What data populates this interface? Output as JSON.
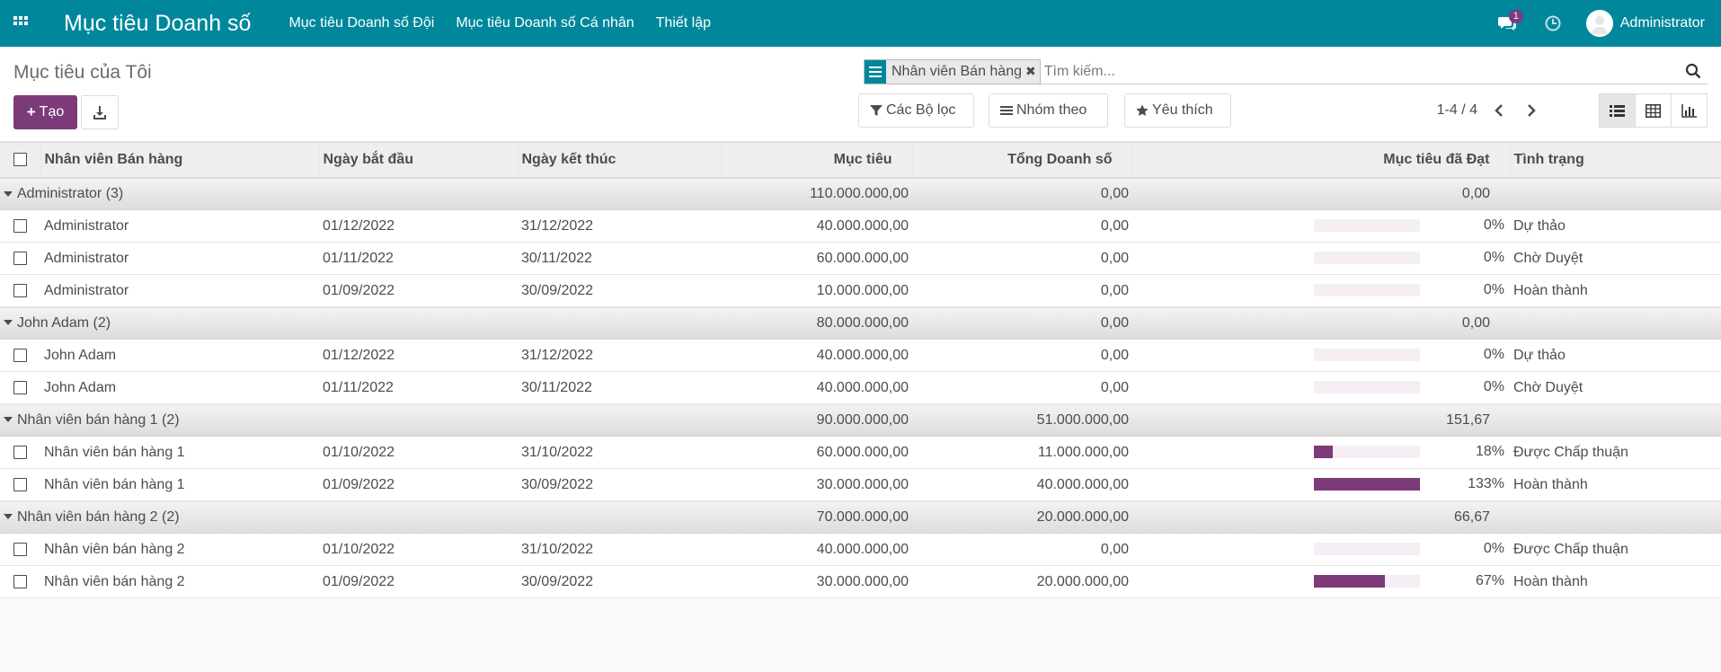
{
  "app": {
    "title": "Mục tiêu Doanh số",
    "menu": [
      "Mục tiêu Doanh số Đội",
      "Mục tiêu Doanh số Cá nhân",
      "Thiết lập"
    ],
    "chat_count": "1",
    "user": "Administrator"
  },
  "control": {
    "breadcrumb": "Mục tiêu của Tôi",
    "create_label": "Tạo",
    "search_facet": "Nhân viên Bán hàng",
    "search_placeholder": "Tìm kiếm...",
    "filters_label": "Các Bộ lọc",
    "groupby_label": "Nhóm theo",
    "favorites_label": "Yêu thích",
    "pager": "1-4 / 4"
  },
  "table": {
    "columns": [
      "Nhân viên Bán hàng",
      "Ngày bắt đầu",
      "Ngày kết thúc",
      "Mục tiêu",
      "Tổng Doanh số",
      "Mục tiêu đã Đạt",
      "Tình trạng"
    ],
    "groups": [
      {
        "name": "Administrator (3)",
        "target": "110.000.000,00",
        "total": "0,00",
        "achieved": "0,00",
        "rows": [
          {
            "name": "Administrator",
            "start": "01/12/2022",
            "end": "31/12/2022",
            "target": "40.000.000,00",
            "total": "0,00",
            "progress": 0,
            "pct": "0%",
            "status": "Dự thảo"
          },
          {
            "name": "Administrator",
            "start": "01/11/2022",
            "end": "30/11/2022",
            "target": "60.000.000,00",
            "total": "0,00",
            "progress": 0,
            "pct": "0%",
            "status": "Chờ Duyệt"
          },
          {
            "name": "Administrator",
            "start": "01/09/2022",
            "end": "30/09/2022",
            "target": "10.000.000,00",
            "total": "0,00",
            "progress": 0,
            "pct": "0%",
            "status": "Hoàn thành"
          }
        ]
      },
      {
        "name": "John Adam (2)",
        "target": "80.000.000,00",
        "total": "0,00",
        "achieved": "0,00",
        "rows": [
          {
            "name": "John Adam",
            "start": "01/12/2022",
            "end": "31/12/2022",
            "target": "40.000.000,00",
            "total": "0,00",
            "progress": 0,
            "pct": "0%",
            "status": "Dự thảo"
          },
          {
            "name": "John Adam",
            "start": "01/11/2022",
            "end": "30/11/2022",
            "target": "40.000.000,00",
            "total": "0,00",
            "progress": 0,
            "pct": "0%",
            "status": "Chờ Duyệt"
          }
        ]
      },
      {
        "name": "Nhân viên bán hàng 1 (2)",
        "target": "90.000.000,00",
        "total": "51.000.000,00",
        "achieved": "151,67",
        "rows": [
          {
            "name": "Nhân viên bán hàng 1",
            "start": "01/10/2022",
            "end": "31/10/2022",
            "target": "60.000.000,00",
            "total": "11.000.000,00",
            "progress": 18,
            "pct": "18%",
            "status": "Được Chấp thuận"
          },
          {
            "name": "Nhân viên bán hàng 1",
            "start": "01/09/2022",
            "end": "30/09/2022",
            "target": "30.000.000,00",
            "total": "40.000.000,00",
            "progress": 100,
            "pct": "133%",
            "status": "Hoàn thành"
          }
        ]
      },
      {
        "name": "Nhân viên bán hàng 2 (2)",
        "target": "70.000.000,00",
        "total": "20.000.000,00",
        "achieved": "66,67",
        "rows": [
          {
            "name": "Nhân viên bán hàng 2",
            "start": "01/10/2022",
            "end": "31/10/2022",
            "target": "40.000.000,00",
            "total": "0,00",
            "progress": 0,
            "pct": "0%",
            "status": "Được Chấp thuận"
          },
          {
            "name": "Nhân viên bán hàng 2",
            "start": "01/09/2022",
            "end": "30/09/2022",
            "target": "30.000.000,00",
            "total": "20.000.000,00",
            "progress": 67,
            "pct": "67%",
            "status": "Hoàn thành"
          }
        ]
      }
    ]
  },
  "colors": {
    "brand": "#00879b",
    "primary": "#7c3a79",
    "progress_bg": "#f6eef5"
  }
}
